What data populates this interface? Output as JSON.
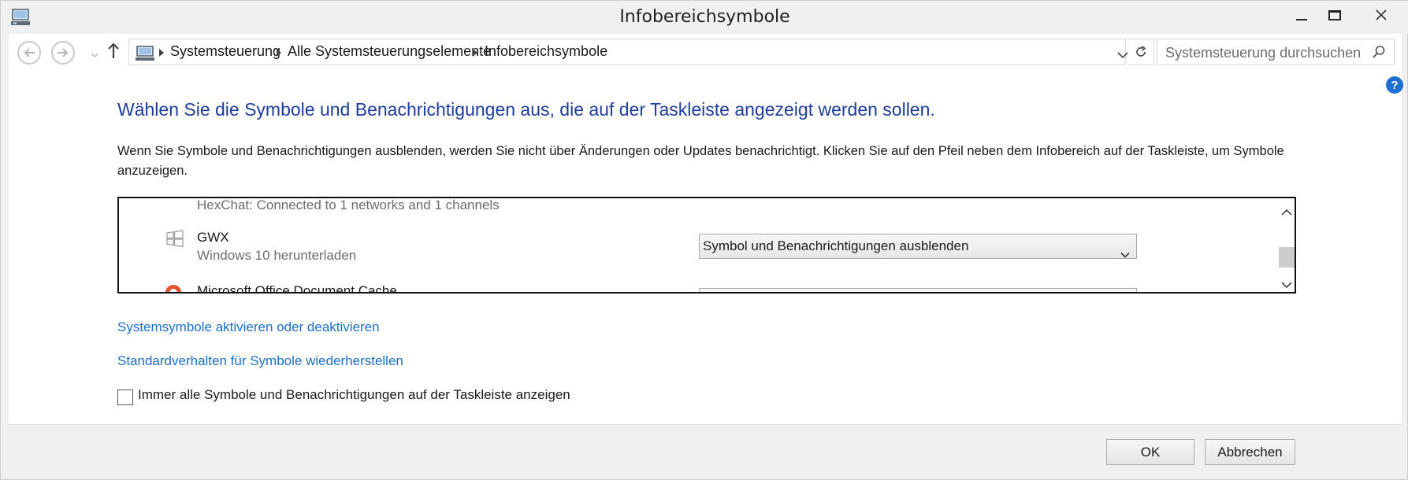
{
  "window": {
    "title": "Infobereichsymbole"
  },
  "address_bar": {
    "breadcrumbs": [
      "Systemsteuerung",
      "Alle Systemsteuerungselemente",
      "Infobereichsymbole"
    ]
  },
  "search": {
    "placeholder": "Systemsteuerung durchsuchen"
  },
  "content": {
    "headline": "Wählen Sie die Symbole und Benachrichtigungen aus, die auf der Taskleiste angezeigt werden sollen.",
    "description": "Wenn Sie Symbole und Benachrichtigungen ausblenden, werden Sie nicht über Änderungen oder Updates benachrichtigt. Klicken Sie auf den Pfeil neben dem Infobereich auf der Taskleiste, um Symbole anzuzeigen.",
    "items": [
      {
        "name": "",
        "desc": "HexChat: Connected to 1 networks and 1 channels",
        "icon": "hexchat-icon",
        "behavior": ""
      },
      {
        "name": "GWX",
        "desc": "Windows 10 herunterladen",
        "icon": "windows-logo-icon",
        "behavior": "Symbol und Benachrichtigungen ausblenden"
      },
      {
        "name": "Microsoft Office Document Cache",
        "desc": "",
        "icon": "office-upload-center-icon",
        "behavior": ""
      }
    ],
    "link_system_icons": "Systemsymbole aktivieren oder deaktivieren",
    "link_restore_defaults": "Standardverhalten für Symbole wiederherstellen",
    "always_show_label": "Immer alle Symbole und Benachrichtigungen auf der Taskleiste anzeigen",
    "always_show_checked": false,
    "help_glyph": "?"
  },
  "footer": {
    "ok_label": "OK",
    "cancel_label": "Abbrechen"
  },
  "colors": {
    "headline": "#1e3d9e",
    "link": "#1e6fc7",
    "help": "#1f6fd1"
  }
}
